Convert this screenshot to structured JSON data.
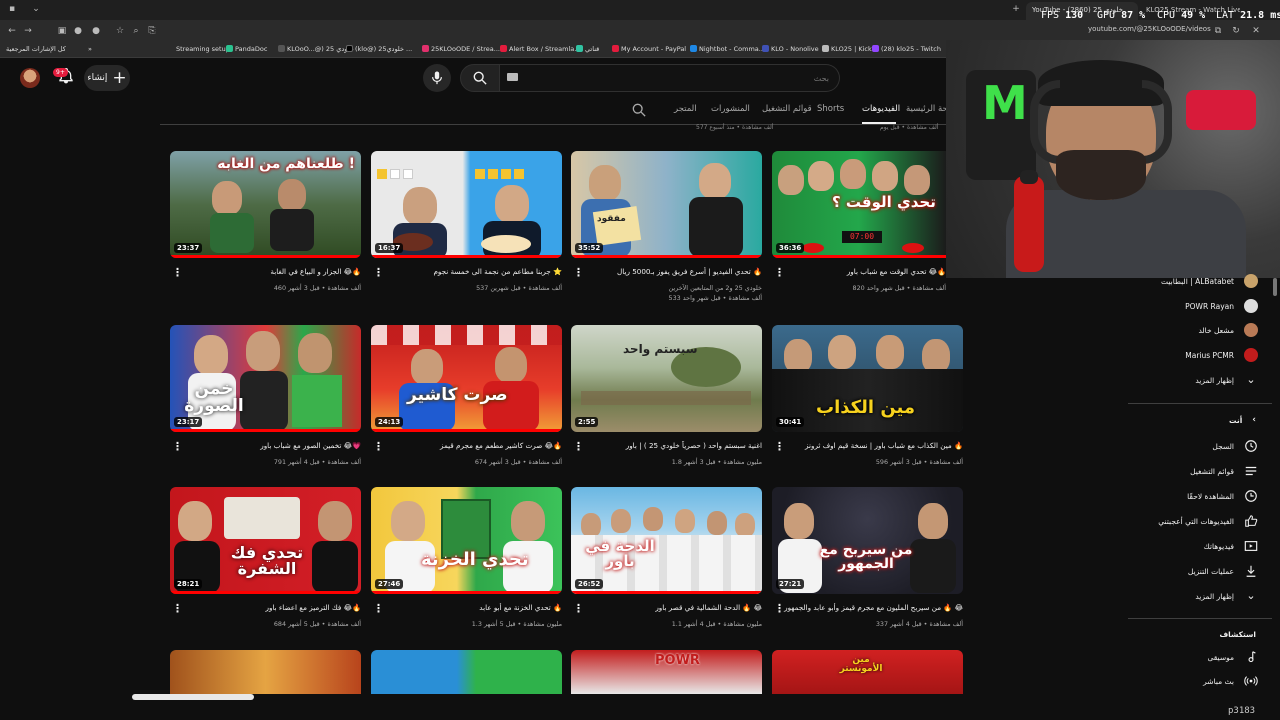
{
  "browser": {
    "active_tab_title": "YouTube - خلودي 25 (2860)",
    "second_tab_title": "KLO25 Stream - Watch Live on",
    "url": "youtube.com/@25KLOoODE/videos",
    "stats": {
      "fps_label": "FPS",
      "fps_value": "130",
      "gpu_label": "GPU",
      "gpu_value": "87 %",
      "cpu_label": "CPU",
      "cpu_value": "49 %",
      "lat_label": "LAT",
      "lat_value": "21.8 ms"
    },
    "bookmarks": [
      {
        "label": "كل الإشارات المرجعية",
        "color": "#666"
      },
      {
        "label": "Streaming setup",
        "color": "#888"
      },
      {
        "label": "PandaDoc",
        "color": "#2ac28f"
      },
      {
        "label": "KLOoO...@) خلودي 25",
        "color": "#444"
      },
      {
        "label": "(klo@) خلودي25 ...",
        "color": "#222"
      },
      {
        "label": "25KLOoODE / Strea...",
        "color": "#e1306c"
      },
      {
        "label": "Alert Box / Streamla...",
        "color": "#e31c3d"
      },
      {
        "label": "قناتي",
        "color": "#31c3a2"
      },
      {
        "label": "My Account - PayPal",
        "color": "#e31c3d"
      },
      {
        "label": "Nightbot - Comma...",
        "color": "#1e88e5"
      },
      {
        "label": "KLO - Nonolive",
        "color": "#3f51b5"
      },
      {
        "label": "KLO25 | Kick",
        "color": "#bbb"
      },
      {
        "label": "(28) klo25 - Twitch",
        "color": "#53fc18"
      }
    ]
  },
  "header": {
    "create_label": "إنشاء",
    "notification_count": "9+",
    "search_placeholder": "بحث"
  },
  "channel_tabs": [
    {
      "label": "الصفحة الرئيسية",
      "active": false
    },
    {
      "label": "الفيديوهات",
      "active": true
    },
    {
      "label": "Shorts",
      "active": false
    },
    {
      "label": "قوائم التشغيل",
      "active": false
    },
    {
      "label": "المنشورات",
      "active": false
    },
    {
      "label": "المتجر",
      "active": false
    }
  ],
  "cutoff_meta": [
    "577 ألف مشاهدة • منذ أسبوع",
    "ألف مشاهدة • قبل يوم"
  ],
  "videos": [
    {
      "title": "طلعناهم من الغابه 😂🔥",
      "display_title": "الجزار و البياع في الغابة 😂🔥",
      "views": "460 ألف مشاهدة",
      "age": "قبل 3 أشهر",
      "duration": "23:37",
      "thumb_text": "طلعناهم من الغابه !"
    },
    {
      "title": "جربنا مطاعم من نجمة الى خمسة نجوم ⭐",
      "views": "537 ألف مشاهدة",
      "age": "قبل شهرين",
      "duration": "16:37",
      "thumb_text": ""
    },
    {
      "title": "تحدي الفيديو | أسرع فريق يفوز بـ5000 ريال 🔥",
      "views": "خلودي 25 و2 من المتابعين الآخرين",
      "age": "533 ألف مشاهدة • قبل شهر واحد",
      "duration": "35:52",
      "thumb_text": "مفقود"
    },
    {
      "title": "تحدي الوقت مع شباب باور 😂🔥",
      "views": "820 ألف مشاهدة",
      "age": "قبل شهر واحد",
      "duration": "36:36",
      "thumb_text": "تحدي الوقت ؟"
    },
    {
      "title": "تخمين الصور مع شباب باور 😂💗",
      "views": "791 ألف مشاهدة",
      "age": "قبل 4 أشهر",
      "duration": "23:17",
      "thumb_text": "خمن الصورة"
    },
    {
      "title": "صرت كاشير مطعم مع مجرم قيمز 😂🔥",
      "views": "674 ألف مشاهدة",
      "age": "قبل 3 أشهر",
      "duration": "24:13",
      "thumb_text": "صرت كاشير"
    },
    {
      "title": "اغنية سبستم واحد ( حصرياً خلودي 25 ) | باور",
      "views": "1.8 مليون مشاهدة",
      "age": "قبل 3 أشهر",
      "duration": "2:55",
      "thumb_text": "سبستم واحد"
    },
    {
      "title": "مين الكذاب مع شباب باور | نسخة قيم اوف ثرونز 🔥",
      "views": "596 ألف مشاهدة",
      "age": "قبل 3 أشهر",
      "duration": "30:41",
      "thumb_text": "مين الكذاب"
    },
    {
      "title": "فك الترميز مع اعضاء باور 😂🔥",
      "views": "684 ألف مشاهدة",
      "age": "قبل 5 أشهر",
      "duration": "28:21",
      "thumb_text": "تحدي فك الشفرة"
    },
    {
      "title": "تحدي الخزنة مع أبو عابد 🔥",
      "views": "1.3 مليون مشاهدة",
      "age": "قبل 5 أشهر",
      "duration": "27:46",
      "thumb_text": "تحدي الخزنة"
    },
    {
      "title": "الدحة الشمالية في قصر باور 🔥 😂",
      "views": "1.1 مليون مشاهدة",
      "age": "قبل 4 أشهر",
      "duration": "26:52",
      "thumb_text": "الدحة في باور"
    },
    {
      "title": "من سيربح المليون مع مجرم قيمز وأبو عابد والجمهور 🔥 😂",
      "views": "337 ألف مشاهدة",
      "age": "قبل 4 أشهر",
      "duration": "27:21",
      "thumb_text": "من سيربح مع الجمهور"
    },
    {
      "title": "",
      "views": "",
      "age": "",
      "duration": "",
      "thumb_text": ""
    },
    {
      "title": "",
      "views": "",
      "age": "",
      "duration": "",
      "thumb_text": ""
    },
    {
      "title": "",
      "views": "",
      "age": "",
      "duration": "",
      "thumb_text": "POWR"
    },
    {
      "title": "",
      "views": "",
      "age": "",
      "duration": "",
      "thumb_text": "مين الأمونستر"
    }
  ],
  "sidebar": {
    "subscriptions": [
      {
        "label": "البطابيت | ALBatabet",
        "color": "#c9a36b"
      },
      {
        "label": "POWR Rayan",
        "color": "#ddd"
      },
      {
        "label": "مشعل خالد",
        "color": "#b97a56"
      },
      {
        "label": "Marius PCMR",
        "color": "#c21c1c"
      }
    ],
    "show_more": "إظهار المزيد",
    "you_heading": "أنت",
    "you_items": [
      {
        "label": "السجل",
        "icon": "history-icon"
      },
      {
        "label": "قوائم التشغيل",
        "icon": "playlist-icon"
      },
      {
        "label": "المشاهدة لاحقًا",
        "icon": "watch-later-icon"
      },
      {
        "label": "الفيديوهات التي أعجبتني",
        "icon": "like-icon"
      },
      {
        "label": "فيديوهاتك",
        "icon": "your-videos-icon"
      },
      {
        "label": "عمليات التنزيل",
        "icon": "download-icon"
      }
    ],
    "show_more_2": "إظهار المزيد",
    "explore_heading": "استكشاف",
    "explore_items": [
      {
        "label": "موسيقى",
        "icon": "music-icon"
      },
      {
        "label": "بث مباشر",
        "icon": "live-icon"
      }
    ]
  },
  "frame_id": "p3183",
  "colors": {
    "accent": "#ff0000",
    "background": "#0f0f0f"
  }
}
